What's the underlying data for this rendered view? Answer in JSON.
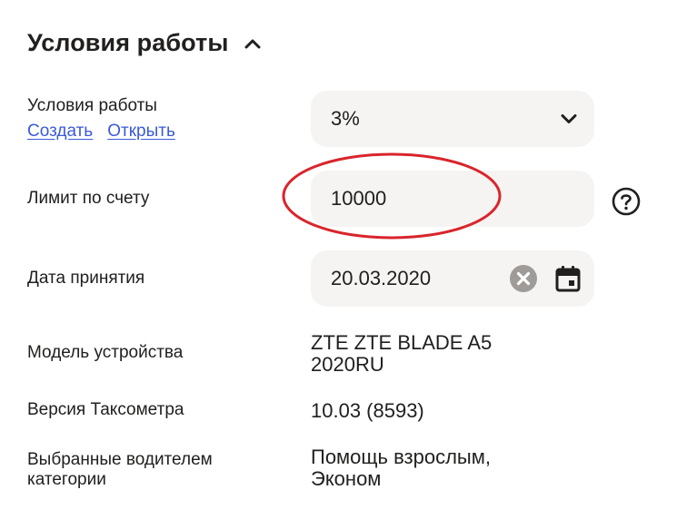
{
  "section": {
    "title": "Условия работы"
  },
  "work_terms": {
    "label": "Условия работы",
    "create_link": "Создать",
    "open_link": "Открыть",
    "selected_value": "3%"
  },
  "account_limit": {
    "label": "Лимит по счету",
    "value": "10000"
  },
  "acceptance_date": {
    "label": "Дата принятия",
    "value": "20.03.2020"
  },
  "device_model": {
    "label": "Модель устройства",
    "value_line1": "ZTE ZTE BLADE A5",
    "value_line2": "2020RU"
  },
  "taximeter_version": {
    "label": "Версия Таксометра",
    "value": "10.03 (8593)"
  },
  "categories": {
    "label_line1": "Выбранные водителем",
    "label_line2": "категории",
    "value_line1": "Помощь взрослым,",
    "value_line2": "Эконом"
  },
  "colors": {
    "field_bg": "#f5f4f2",
    "link": "#3a5ad9",
    "annotation_red": "#d9252b",
    "clear_icon": "#9e9b98"
  },
  "icons": [
    "chevron-up-icon",
    "chevron-down-icon",
    "help-circle-icon",
    "clear-icon",
    "calendar-icon"
  ]
}
